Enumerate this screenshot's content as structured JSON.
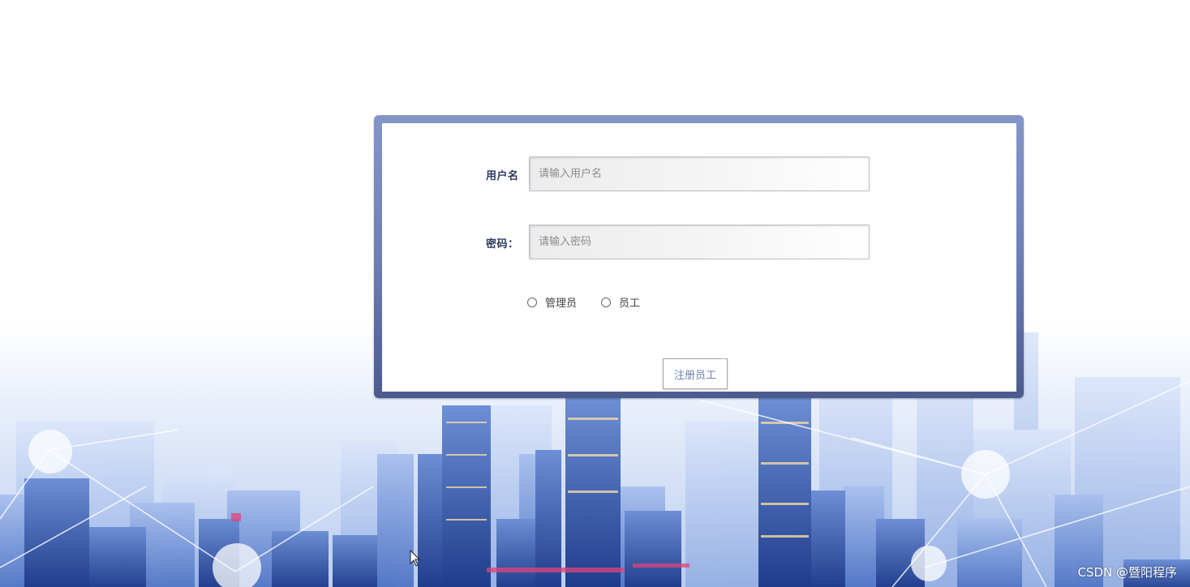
{
  "login_form": {
    "username_label": "用户名",
    "username_placeholder": "请输入用户名",
    "password_label": "密码：",
    "password_placeholder": "请输入密码",
    "roles": [
      {
        "label": "管理员"
      },
      {
        "label": "员工"
      }
    ],
    "register_button": "注册员工"
  },
  "watermark": "CSDN @暨阳程序",
  "colors": {
    "card_border": "#7083bd",
    "label_text": "#2b3a5e",
    "button_text": "#6f7fb0",
    "top_bar": "#0e1f63"
  },
  "icons": [
    "radio-unselected-icon",
    "mouse-pointer-icon"
  ]
}
